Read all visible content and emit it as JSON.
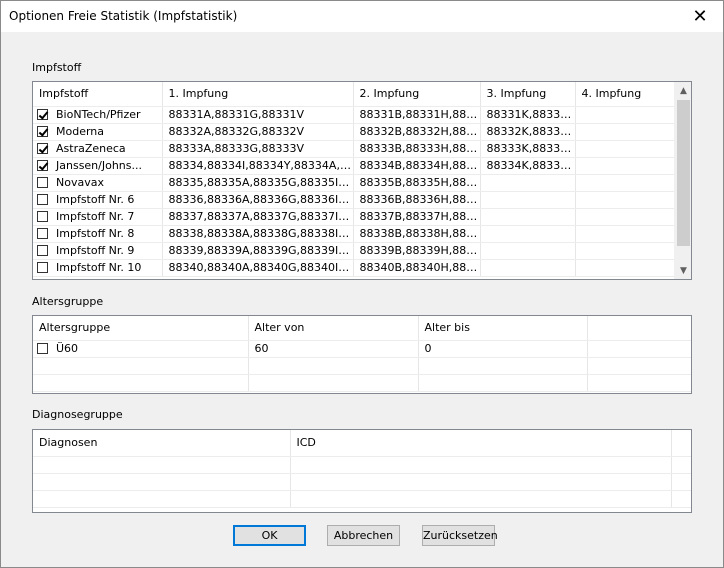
{
  "window": {
    "title": "Optionen Freie Statistik (Impfstatistik)",
    "close_glyph": "✕"
  },
  "impfstoff": {
    "group_label": "Impfstoff",
    "columns": [
      "Impfstoff",
      "1. Impfung",
      "2. Impfung",
      "3. Impfung",
      "4. Impfung"
    ],
    "rows": [
      {
        "checked": true,
        "name": "BioNTech/Pfizer",
        "i1": "88331A,88331G,88331V",
        "i2": "88331B,88331H,883...",
        "i3": "88331K,88331...",
        "i4": ""
      },
      {
        "checked": true,
        "name": "Moderna",
        "i1": "88332A,88332G,88332V",
        "i2": "88332B,88332H,883...",
        "i3": "88332K,88332...",
        "i4": ""
      },
      {
        "checked": true,
        "name": "AstraZeneca",
        "i1": "88333A,88333G,88333V",
        "i2": "88333B,88333H,883...",
        "i3": "88333K,88333...",
        "i4": ""
      },
      {
        "checked": true,
        "name": "Janssen/Johns...",
        "i1": "88334,88334I,88334Y,88334A,883...",
        "i2": "88334B,88334H,883...",
        "i3": "88334K,88334...",
        "i4": ""
      },
      {
        "checked": false,
        "name": "Novavax",
        "i1": "88335,88335A,88335G,88335I,88...",
        "i2": "88335B,88335H,883...",
        "i3": "",
        "i4": ""
      },
      {
        "checked": false,
        "name": "Impfstoff Nr. 6",
        "i1": "88336,88336A,88336G,88336I,88...",
        "i2": "88336B,88336H,883...",
        "i3": "",
        "i4": ""
      },
      {
        "checked": false,
        "name": "Impfstoff Nr. 7",
        "i1": "88337,88337A,88337G,88337I,88...",
        "i2": "88337B,88337H,883...",
        "i3": "",
        "i4": ""
      },
      {
        "checked": false,
        "name": "Impfstoff Nr. 8",
        "i1": "88338,88338A,88338G,88338I,88...",
        "i2": "88338B,88338H,883...",
        "i3": "",
        "i4": ""
      },
      {
        "checked": false,
        "name": "Impfstoff Nr. 9",
        "i1": "88339,88339A,88339G,88339I,88...",
        "i2": "88339B,88339H,883...",
        "i3": "",
        "i4": ""
      },
      {
        "checked": false,
        "name": "Impfstoff Nr. 10",
        "i1": "88340,88340A,88340G,88340I,88...",
        "i2": "88340B,88340H,883...",
        "i3": "",
        "i4": ""
      }
    ],
    "scroll_up_glyph": "▲",
    "scroll_down_glyph": "▼"
  },
  "altersgruppe": {
    "group_label": "Altersgruppe",
    "columns": [
      "Altersgruppe",
      "Alter von",
      "Alter bis"
    ],
    "rows": [
      {
        "checked": false,
        "name": "Ü60",
        "von": "60",
        "bis": "0"
      }
    ]
  },
  "diagnosegruppe": {
    "group_label": "Diagnosegruppe",
    "columns": [
      "Diagnosen",
      "ICD"
    ]
  },
  "buttons": {
    "ok": "OK",
    "cancel": "Abbrechen",
    "reset": "Zurücksetzen"
  }
}
